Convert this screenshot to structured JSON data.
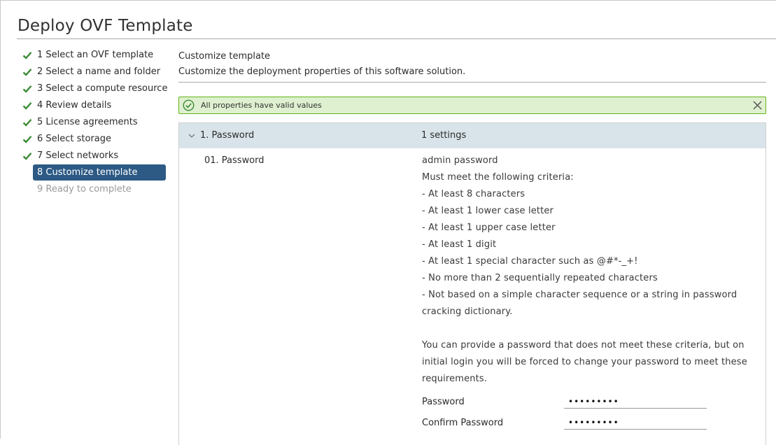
{
  "wizard": {
    "title": "Deploy OVF Template"
  },
  "steps": [
    {
      "label": "1 Select an OVF template",
      "state": "done"
    },
    {
      "label": "2 Select a name and folder",
      "state": "done"
    },
    {
      "label": "3 Select a compute resource",
      "state": "done"
    },
    {
      "label": "4 Review details",
      "state": "done"
    },
    {
      "label": "5 License agreements",
      "state": "done"
    },
    {
      "label": "6 Select storage",
      "state": "done"
    },
    {
      "label": "7 Select networks",
      "state": "done"
    },
    {
      "label": "8 Customize template",
      "state": "active"
    },
    {
      "label": "9 Ready to complete",
      "state": "disabled"
    }
  ],
  "main": {
    "title": "Customize template",
    "description": "Customize the deployment properties of this software solution."
  },
  "alert": {
    "text": "All properties have valid values",
    "status_color": "#60b515",
    "icon": "check-circle-icon"
  },
  "group": {
    "name": "1. Password",
    "count": "1 settings",
    "expanded": true
  },
  "property": {
    "name": "01. Password",
    "description_lines": [
      "admin password",
      "Must meet the following criteria:",
      "- At least 8 characters",
      "- At least 1 lower case letter",
      "- At least 1 upper case letter",
      "- At least 1 digit",
      "- At least 1 special character such as @#*-_+!",
      "- No more than 2 sequentially repeated characters",
      "- Not based on a simple character sequence or a string in password cracking dictionary."
    ],
    "note": "You can provide a password that does not meet these criteria, but on initial login you will be forced to change your password to meet these requirements.",
    "password_label": "Password",
    "password_value": "•••••••••",
    "confirm_label": "Confirm Password",
    "confirm_value": "•••••••••"
  },
  "colors": {
    "accent": "#2c5a84",
    "check": "#3d8b37",
    "group_header": "#d9e4ea",
    "alert_bg": "#dff0d0"
  }
}
